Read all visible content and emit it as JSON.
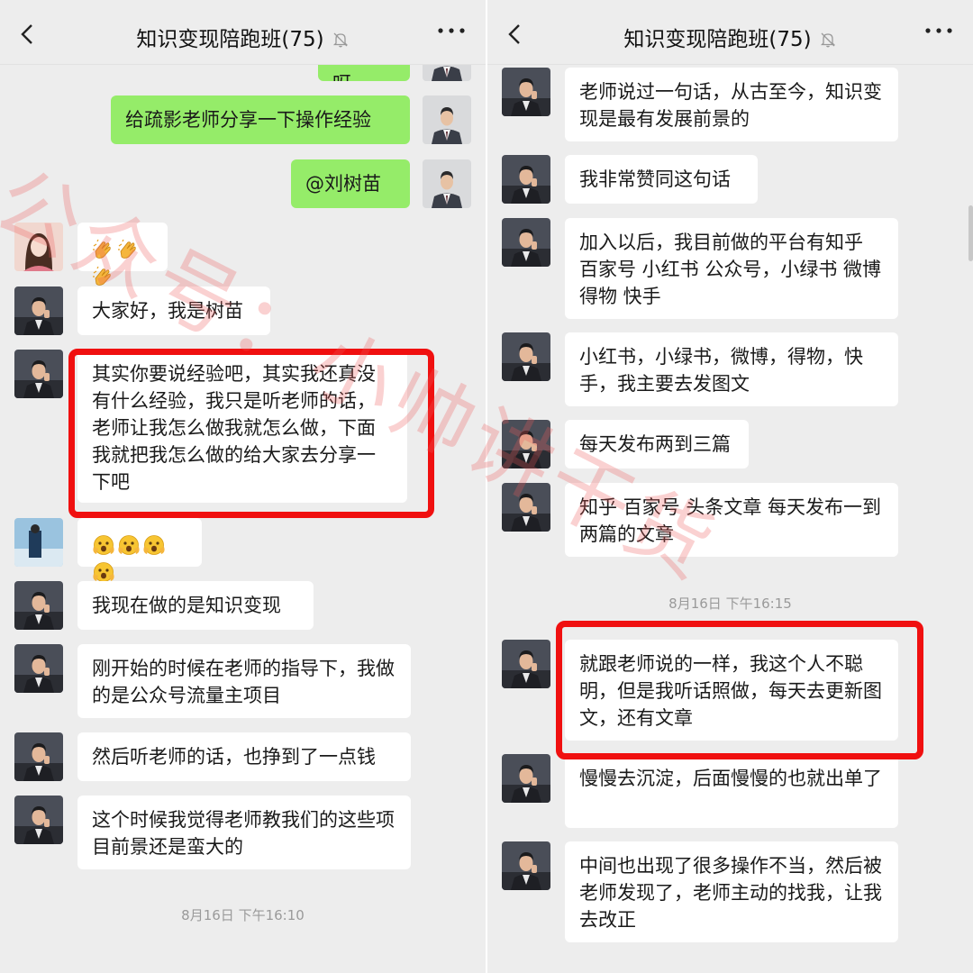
{
  "left": {
    "title": "知识变现陪跑班(75)",
    "messages": {
      "top_partial": "大家好呀",
      "m1": "给疏影老师分享一下操作经验",
      "m2": "@刘树苗",
      "m4": "大家好，我是树苗",
      "m5": "其实你要说经验吧，其实我还真没有什么经验，我只是听老师的话，老师让我怎么做我就怎么做，下面我就把我怎么做的给大家去分享一下吧",
      "m7": "我现在做的是知识变现",
      "m8": "刚开始的时候在老师的指导下，我做的是公众号流量主项目",
      "m9": "然后听老师的话，也挣到了一点钱",
      "m10": "这个时候我觉得老师教我们的这些项目前景还是蛮大的"
    },
    "timestamp": "8月16日 下午16:10",
    "clap_emojis": [
      "clapping-hands",
      "clapping-hands",
      "clapping-hands"
    ],
    "face_emojis": [
      "surprised-face",
      "surprised-face",
      "surprised-face",
      "surprised-face"
    ]
  },
  "right": {
    "title": "知识变现陪跑班(75)",
    "messages": {
      "r1": "老师说过一句话，从古至今，知识变现是最有发展前景的",
      "r2": "我非常赞同这句话",
      "r3": "加入以后，我目前做的平台有知乎 百家号 小红书 公众号，小绿书 微博 得物 快手",
      "r4": "小红书，小绿书，微博，得物，快手，我主要去发图文",
      "r5": "每天发布两到三篇",
      "r6": "知乎 百家号 头条文章 每天发布一到两篇的文章",
      "r7": "就跟老师说的一样，我这个人不聪明，但是我听话照做，每天去更新图文，还有文章",
      "r8": "慢慢去沉淀，后面慢慢的也就出单了",
      "r9": "中间也出现了很多操作不当，然后被老师发现了，老师主动的找我，让我去改正"
    },
    "timestamp": "8月16日 下午16:15"
  },
  "watermark": "公众号：小帅讲干货",
  "colors": {
    "chat_bg": "#ededed",
    "bubble_in": "#ffffff",
    "bubble_out": "#95ec69",
    "highlight": "#f01010",
    "watermark": "#ec5a5a"
  },
  "icons": [
    "back-chevron-icon",
    "mute-bell-icon",
    "more-dots-icon"
  ]
}
